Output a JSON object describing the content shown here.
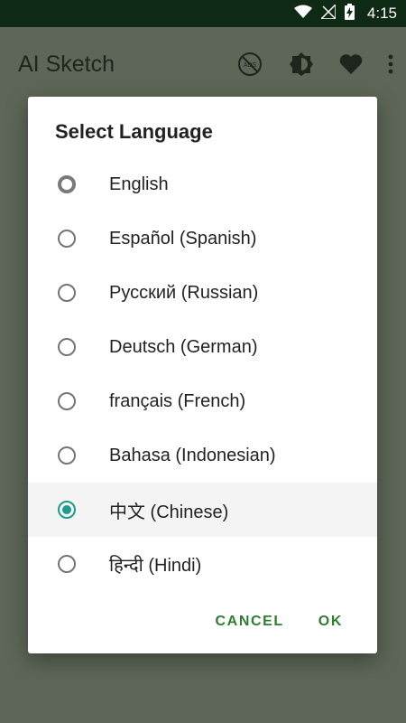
{
  "status_bar": {
    "time": "4:15"
  },
  "app_bar": {
    "title": "AI Sketch",
    "icons": [
      "ads-off-icon",
      "brightness-icon",
      "heart-icon",
      "more-vert-icon"
    ]
  },
  "dialog": {
    "title": "Select Language",
    "options": [
      {
        "label": "English",
        "state": "focused"
      },
      {
        "label": "Español (Spanish)",
        "state": "unchecked"
      },
      {
        "label": "Русский (Russian)",
        "state": "unchecked"
      },
      {
        "label": "Deutsch (German)",
        "state": "unchecked"
      },
      {
        "label": "français (French)",
        "state": "unchecked"
      },
      {
        "label": "Bahasa (Indonesian)",
        "state": "unchecked"
      },
      {
        "label": "中文 (Chinese)",
        "state": "checked"
      },
      {
        "label": "हिन्दी (Hindi)",
        "state": "unchecked"
      }
    ],
    "cancel_label": "CANCEL",
    "ok_label": "OK"
  },
  "colors": {
    "accent": "#1e9b8a",
    "button_text": "#2e7d32",
    "status_bar": "#0e2a14",
    "scrim_background": "#5d6657"
  }
}
